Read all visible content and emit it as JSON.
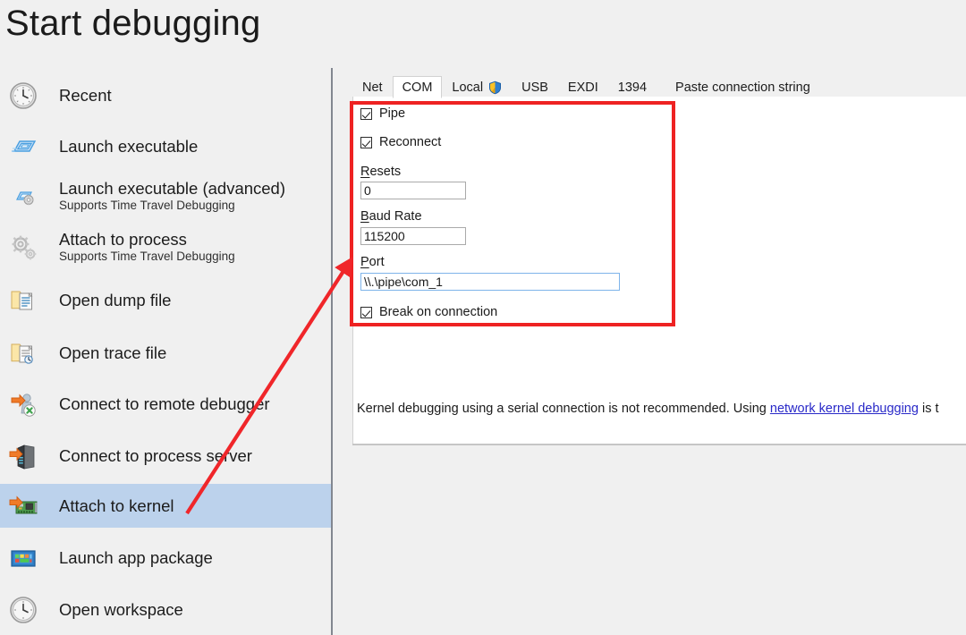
{
  "page": {
    "title": "Start debugging"
  },
  "sidebar": {
    "items": [
      {
        "label": "Recent",
        "sub": "",
        "icon": "clock-icon",
        "selected": false
      },
      {
        "label": "Launch executable",
        "sub": "",
        "icon": "launch-executable-icon",
        "selected": false
      },
      {
        "label": "Launch executable (advanced)",
        "sub": "Supports Time Travel Debugging",
        "icon": "launch-executable-advanced-icon",
        "selected": false
      },
      {
        "label": "Attach to process",
        "sub": "Supports Time Travel Debugging",
        "icon": "gears-icon",
        "selected": false
      },
      {
        "label": "Open dump file",
        "sub": "",
        "icon": "folder-dump-icon",
        "selected": false
      },
      {
        "label": "Open trace file",
        "sub": "",
        "icon": "folder-trace-icon",
        "selected": false
      },
      {
        "label": "Connect to remote debugger",
        "sub": "",
        "icon": "remote-debugger-icon",
        "selected": false
      },
      {
        "label": "Connect to process server",
        "sub": "",
        "icon": "process-server-icon",
        "selected": false
      },
      {
        "label": "Attach to kernel",
        "sub": "",
        "icon": "kernel-card-icon",
        "selected": true
      },
      {
        "label": "Launch app package",
        "sub": "",
        "icon": "app-package-icon",
        "selected": false
      },
      {
        "label": "Open workspace",
        "sub": "",
        "icon": "clock-icon",
        "selected": false
      }
    ]
  },
  "tabs": [
    {
      "label": "Net",
      "active": false,
      "shield": false
    },
    {
      "label": "COM",
      "active": true,
      "shield": false
    },
    {
      "label": "Local",
      "active": false,
      "shield": true
    },
    {
      "label": "USB",
      "active": false,
      "shield": false
    },
    {
      "label": "EXDI",
      "active": false,
      "shield": false
    },
    {
      "label": "1394",
      "active": false,
      "shield": false
    },
    {
      "label": "Paste connection string",
      "active": false,
      "shield": false
    }
  ],
  "form": {
    "pipe": {
      "label": "Pipe",
      "checked": true
    },
    "reconnect": {
      "label": "Reconnect",
      "checked": true
    },
    "resets": {
      "label_accel": "R",
      "label_rest": "esets",
      "value": "0"
    },
    "baud_rate": {
      "label_accel": "B",
      "label_rest": "aud Rate",
      "value": "115200"
    },
    "port": {
      "label_accel": "P",
      "label_rest": "ort",
      "value": "\\\\.\\pipe\\com_1"
    },
    "break_on_connection": {
      "label": "Break on connection",
      "checked": true
    }
  },
  "helper": {
    "text_before": "Kernel debugging using a serial connection is not recommended. Using ",
    "link_text": "network kernel debugging",
    "text_after": " is t"
  },
  "colors": {
    "selection": "#bcd2ec",
    "annotation_red": "#ee2222",
    "link_blue": "#2929c8",
    "focus_border": "#7eb4ea"
  }
}
